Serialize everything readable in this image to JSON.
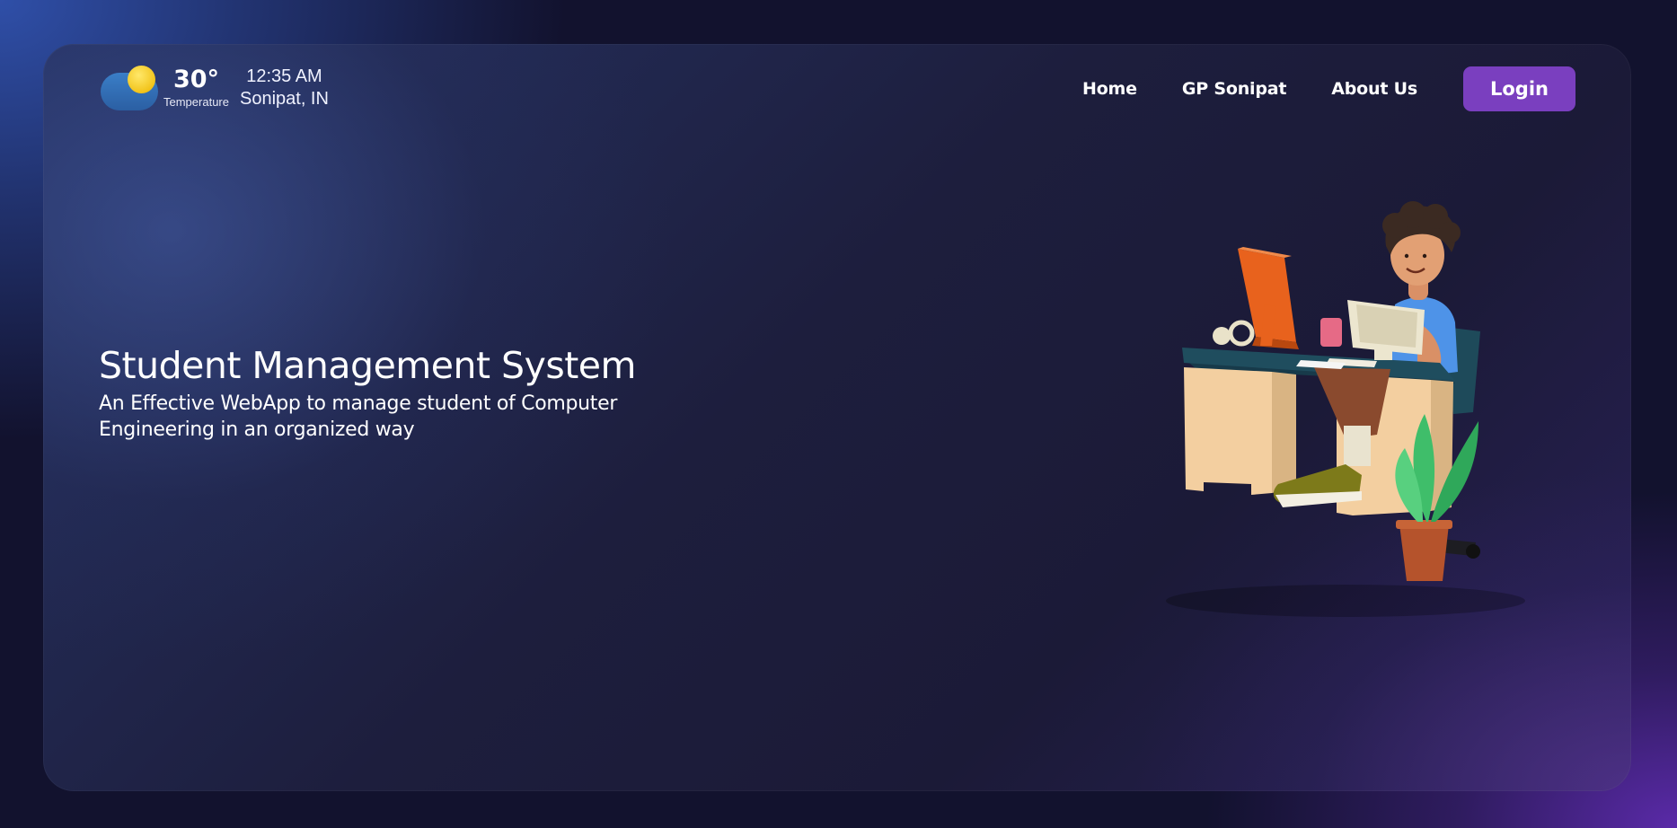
{
  "weather": {
    "icon": "partly-cloudy-icon",
    "temperature": "30°",
    "temperature_label": "Temperature",
    "time": "12:35 AM",
    "location": "Sonipat, IN"
  },
  "nav": {
    "items": [
      {
        "label": "Home"
      },
      {
        "label": "GP Sonipat"
      },
      {
        "label": "About Us"
      }
    ],
    "login_label": "Login"
  },
  "hero": {
    "title": "Student Management System",
    "subtitle": "An Effective WebApp to manage student of Computer Engineering in an organized way"
  },
  "colors": {
    "accent": "#7a3fbf",
    "background_dark": "#12122e"
  }
}
